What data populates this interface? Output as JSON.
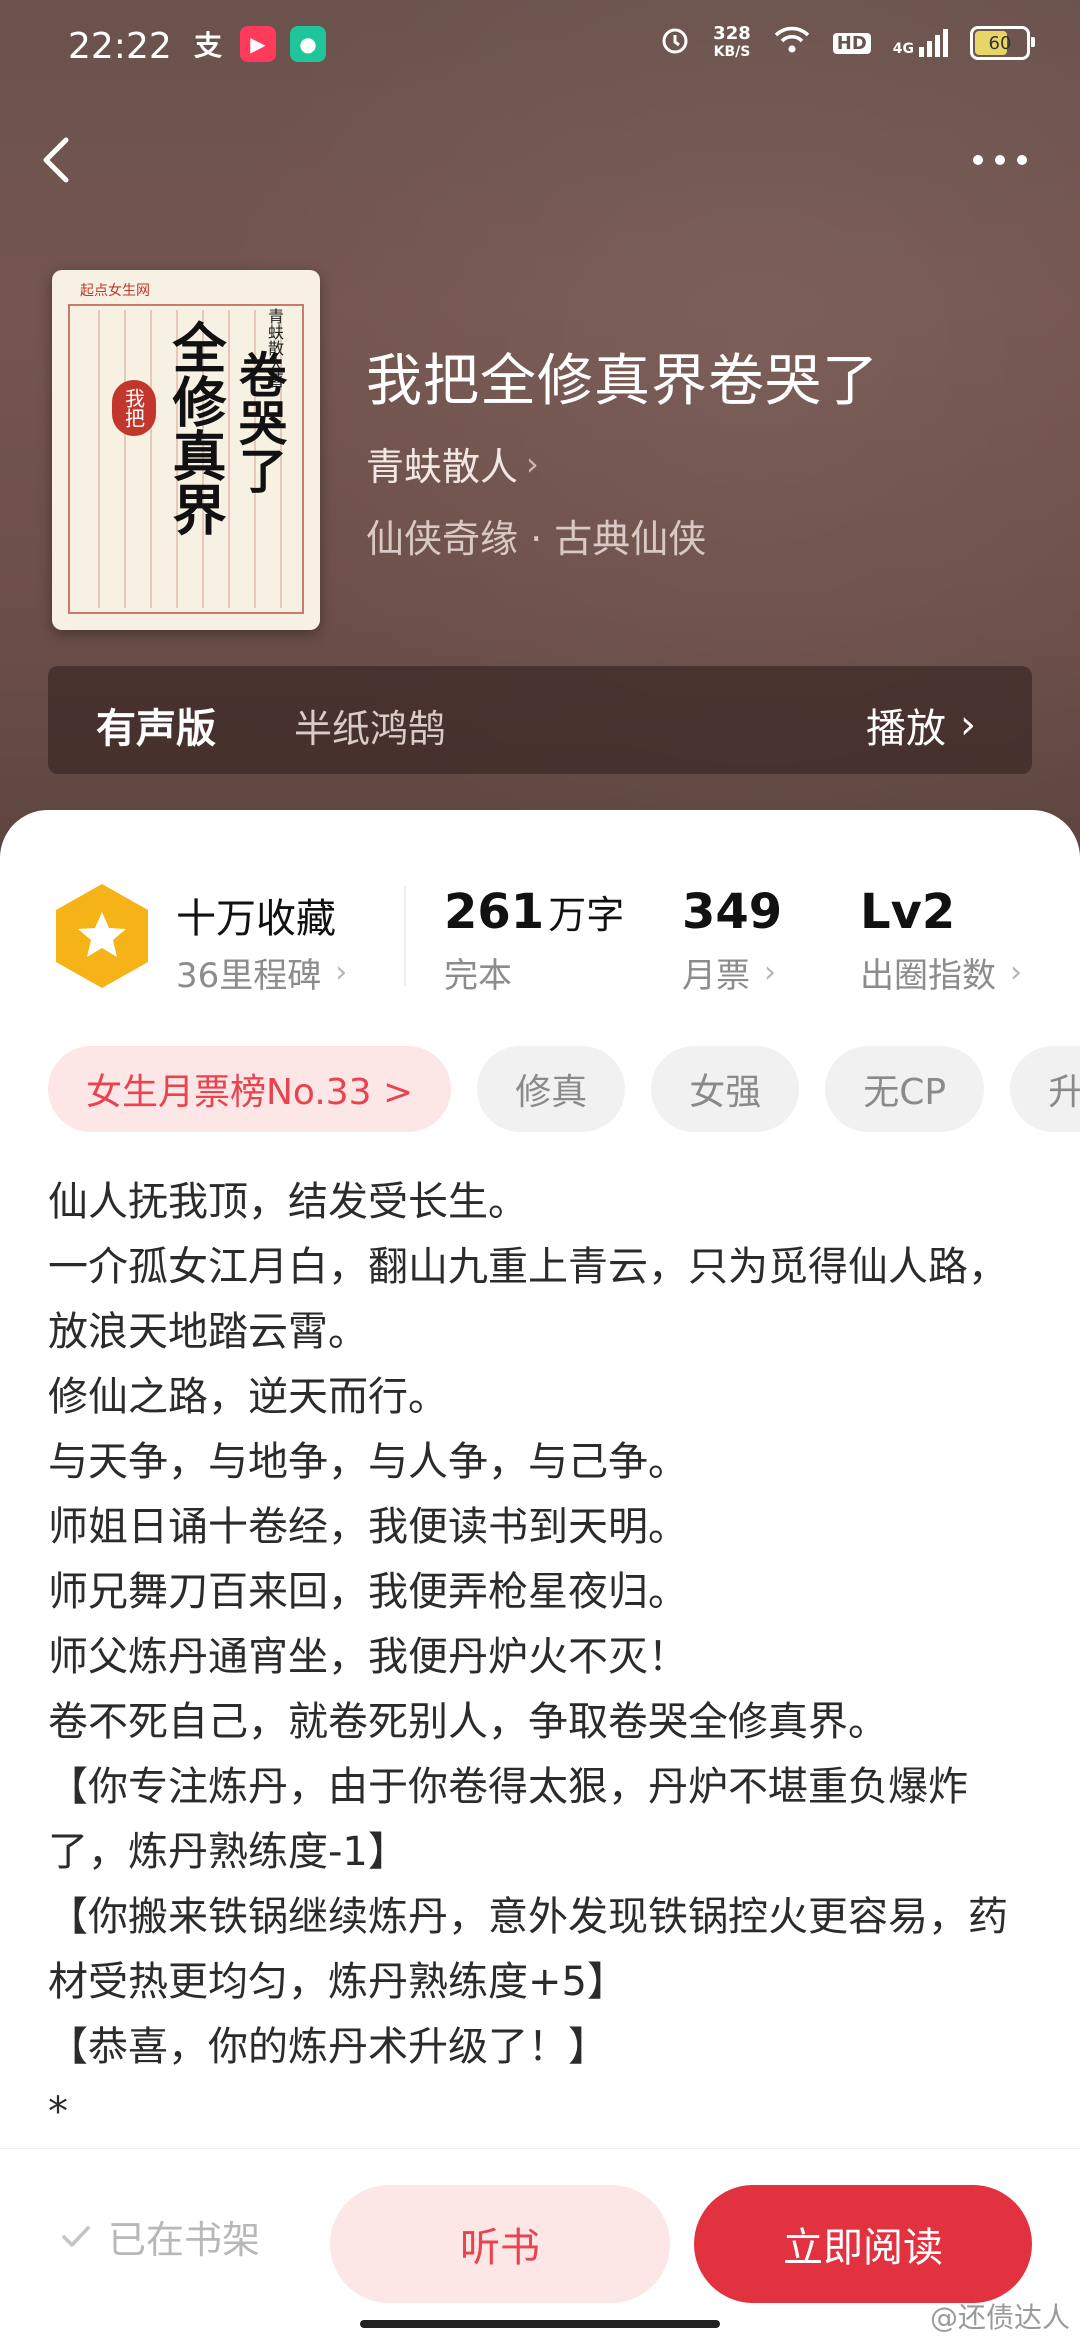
{
  "status_bar": {
    "time": "22:22",
    "speed_value": "328",
    "speed_unit": "KB/S",
    "hd": "HD",
    "network": "4G",
    "battery": "60",
    "icons": [
      "alipay-icon",
      "video-app-icon",
      "chat-app-icon",
      "alarm-icon",
      "wifi-icon",
      "signal-icon",
      "battery-icon"
    ]
  },
  "nav": {
    "back_icon": "chevron-left-icon",
    "more_icon": "more-icon"
  },
  "book": {
    "title": "我把全修真界卷哭了",
    "author": "青蚨散人",
    "genre": "仙侠奇缘 · 古典仙侠",
    "cover": {
      "publisher_logo": "起点女生网",
      "calligraphy_a": "全修真界",
      "calligraphy_b": "卷哭了",
      "seal": "我把",
      "author_vertical": "青蚨散人著"
    }
  },
  "audio": {
    "label": "有声版",
    "narrator": "半纸鸿鹄",
    "play_label": "播放"
  },
  "stats": {
    "collect_title": "十万收藏",
    "collect_sub": "36里程碑",
    "words_value": "261",
    "words_unit": "万字",
    "words_label": "完本",
    "tickets_value": "349",
    "tickets_label": "月票",
    "level_value": "Lv2",
    "level_label": "出圈指数"
  },
  "tags": [
    "女生月票榜No.33 >",
    "修真",
    "女强",
    "无CP",
    "升级"
  ],
  "synopsis": [
    "仙人抚我顶，结发受长生。",
    "一介孤女江月白，翻山九重上青云，只为觅得仙人路，放浪天地踏云霄。",
    "修仙之路，逆天而行。",
    "与天争，与地争，与人争，与己争。",
    "师姐日诵十卷经，我便读书到天明。",
    "师兄舞刀百来回，我便弄枪星夜归。",
    "师父炼丹通宵坐，我便丹炉火不灭！",
    "卷不死自己，就卷死别人，争取卷哭全修真界。",
    "【你专注炼丹，由于你卷得太狠，丹炉不堪重负爆炸了，炼丹熟练度-1】",
    "【你搬来铁锅继续炼丹，意外发现铁锅控火更容易，药材受热更均匀，炼丹熟练度+5】",
    "【恭喜，你的炼丹术升级了！】",
    "*"
  ],
  "bottom": {
    "shelf_label": "已在书架",
    "listen_label": "听书",
    "read_label": "立即阅读"
  },
  "watermark": "@还债达人",
  "colors": {
    "accent": "#e2323f",
    "accent_light": "#fde6e6",
    "badge": "#f6b318",
    "hero_bg": "#6f524d"
  }
}
